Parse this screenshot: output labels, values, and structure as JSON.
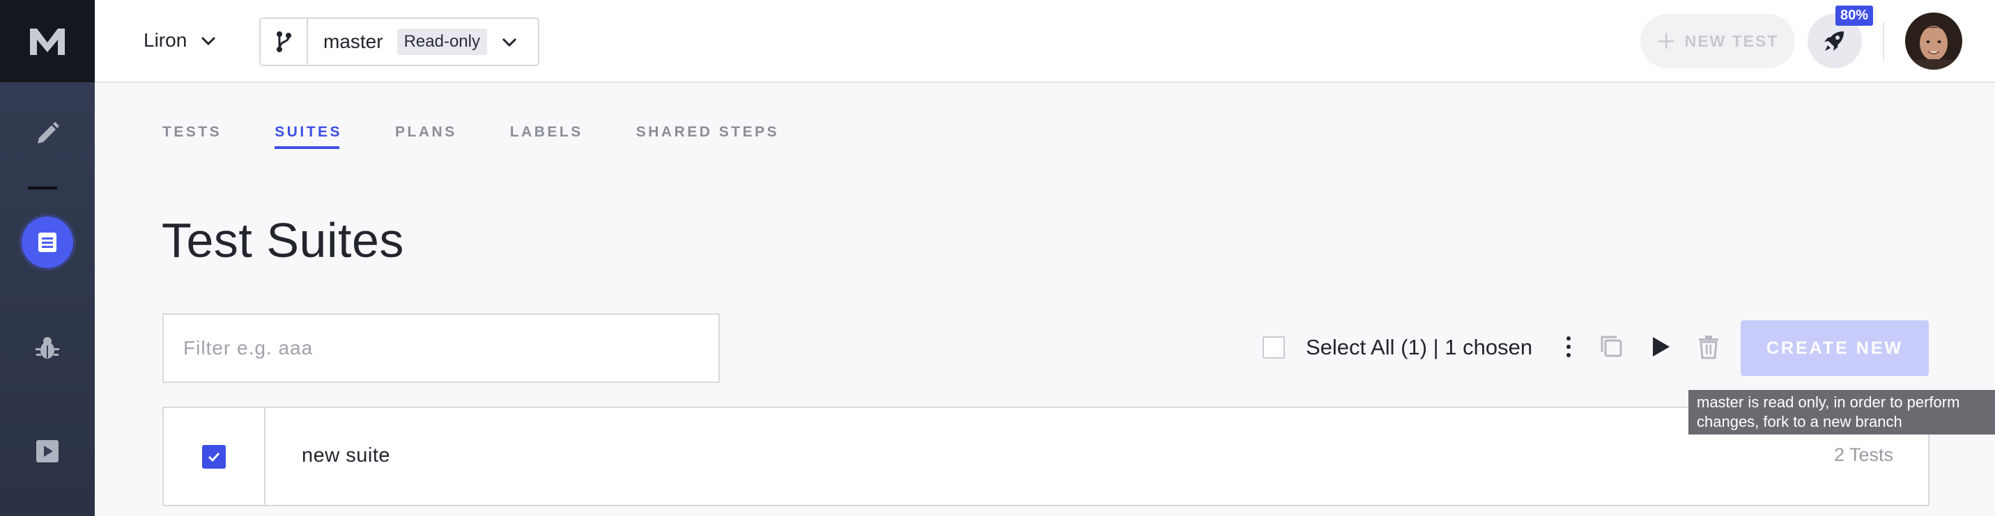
{
  "workspace": {
    "name": "Liron"
  },
  "branch": {
    "name": "master",
    "badge": "Read-only"
  },
  "header": {
    "new_test_label": "NEW TEST",
    "progress_badge": "80%"
  },
  "tabs": [
    {
      "label": "TESTS",
      "active": false
    },
    {
      "label": "SUITES",
      "active": true
    },
    {
      "label": "PLANS",
      "active": false
    },
    {
      "label": "LABELS",
      "active": false
    },
    {
      "label": "SHARED STEPS",
      "active": false
    }
  ],
  "page": {
    "title": "Test Suites"
  },
  "filter": {
    "placeholder": "Filter e.g. aaa",
    "value": ""
  },
  "toolbar": {
    "select_all_label": "Select All (1) | 1 chosen",
    "create_label": "CREATE NEW",
    "tooltip": "master is read only, in order to perform changes, fork to a new branch"
  },
  "suites": [
    {
      "name": "new suite",
      "count": "2 Tests",
      "checked": true
    }
  ],
  "sidebar": {
    "items": [
      {
        "icon": "pencil-icon",
        "active": false
      },
      {
        "icon": "suites-icon",
        "active": true
      },
      {
        "icon": "bug-icon",
        "active": false
      },
      {
        "icon": "play-icon",
        "active": false
      }
    ]
  },
  "colors": {
    "accent": "#3d4fe5",
    "sidebar": "#343d54",
    "create_disabled": "#c7ccfa"
  }
}
